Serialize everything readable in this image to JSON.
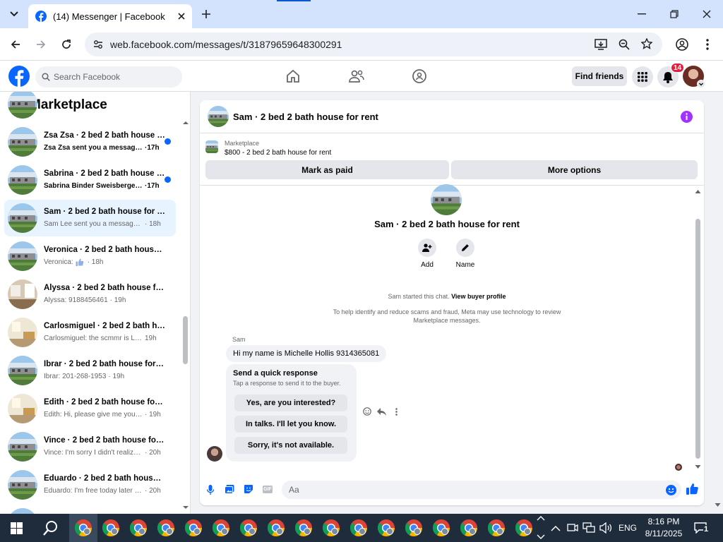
{
  "browser": {
    "tab_title": "(14) Messenger | Facebook",
    "url": "web.facebook.com/messages/t/31879659648300291"
  },
  "header": {
    "search_placeholder": "Search Facebook",
    "find_friends": "Find friends",
    "notification_count": "14"
  },
  "sidebar": {
    "title": "Marketplace",
    "conversations": [
      {
        "name": "Zsa Zsa · 2 bed 2 bath house f...",
        "preview": "Zsa Zsa sent you a message a...",
        "time": "·17h",
        "unread": true,
        "photo": "house"
      },
      {
        "name": "Sabrina · 2 bed 2 bath house f...",
        "preview": "Sabrina Binder Sweisberger se...",
        "time": "·17h",
        "unread": true,
        "photo": "house"
      },
      {
        "name": "Sam · 2 bed 2 bath house for rent",
        "preview": "Sam Lee sent you a message abo...",
        "time": "· 18h",
        "unread": false,
        "active": true,
        "photo": "house"
      },
      {
        "name": "Veronica · 2 bed 2 bath house f...",
        "preview": "Veronica:",
        "time": "· 18h",
        "unread": false,
        "like": true,
        "photo": "house"
      },
      {
        "name": "Alyssa · 2 bed 2 bath house for ...",
        "preview": "Alyssa: 9188456461",
        "time": "· 19h",
        "unread": false,
        "photo": "interior"
      },
      {
        "name": "Carlosmiguel · 2 bed 2 bath ho...",
        "preview": "Carlosmiguel: the scmmr is LISHA...",
        "time": "19h",
        "unread": false,
        "photo": "room"
      },
      {
        "name": "Ibrar · 2 bed 2 bath house for r...",
        "preview": "Ibrar: 201-268-1953",
        "time": "· 19h",
        "unread": false,
        "photo": "house"
      },
      {
        "name": "Edith · 2 bed 2 bath house for r...",
        "preview": "Edith: Hi, please give me your nu...",
        "time": "· 19h",
        "unread": false,
        "photo": "room"
      },
      {
        "name": "Vince · 2 bed 2 bath house for r...",
        "preview": "Vince: I'm sorry I didn't realize th...",
        "time": "· 20h",
        "unread": false,
        "photo": "house"
      },
      {
        "name": "Eduardo · 2 bed 2 bath house f...",
        "preview": "Eduardo: I'm free today later toni...",
        "time": "· 20h",
        "unread": false,
        "photo": "house"
      }
    ]
  },
  "chat": {
    "title": "Sam · 2 bed 2 bath house for rent",
    "marketplace_label": "Marketplace",
    "listing": "$800 - 2 bed 2 bath house for rent",
    "mark_paid": "Mark as paid",
    "more_options": "More options",
    "intro_title": "Sam · 2 bed 2 bath house for rent",
    "add_label": "Add",
    "name_label": "Name",
    "started_text": "Sam started this chat.",
    "view_buyer": "View buyer profile",
    "disclaimer": "To help identify and reduce scams and fraud, Meta may use technology to review Marketplace messages.",
    "sender": "Sam",
    "message": "Hi my name is Michelle Hollis 9314365081",
    "quick_title": "Send a quick response",
    "quick_sub": "Tap a response to send it to the buyer.",
    "quick_responses": [
      "Yes, are you interested?",
      "In talks. I'll let you know.",
      "Sorry, it's not available."
    ],
    "composer_placeholder": "Aa"
  },
  "taskbar": {
    "language": "ENG",
    "time": "8:16 PM",
    "date": "8/11/2025",
    "notification_count": "1"
  },
  "colors": {
    "fb_blue": "#0866ff",
    "messenger_purple": "#a033ff"
  }
}
